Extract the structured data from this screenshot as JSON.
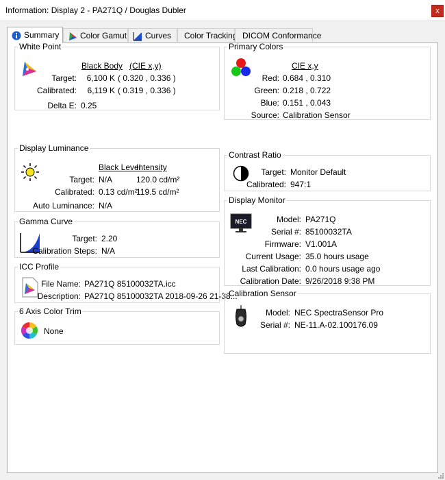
{
  "window": {
    "title": "Information: Display 2 - PA271Q / Douglas Dubler",
    "close_glyph": "x"
  },
  "tabs": [
    {
      "label": "Summary",
      "icon": "info-icon"
    },
    {
      "label": "Color Gamut",
      "icon": "gamut-icon"
    },
    {
      "label": "Curves",
      "icon": "curves-icon"
    },
    {
      "label": "Color Tracking",
      "icon": ""
    },
    {
      "label": "DICOM Conformance",
      "icon": ""
    }
  ],
  "white_point": {
    "title": "White Point",
    "col_black_body": "Black Body",
    "col_cie": "(CIE x,y)",
    "target_label": "Target:",
    "target_value": "6,100 K",
    "target_cie": "( 0.320 , 0.336 )",
    "calibrated_label": "Calibrated:",
    "calibrated_value": "6,119 K",
    "calibrated_cie": "( 0.319 , 0.336 )",
    "delta_label": "Delta E:",
    "delta_value": "0.25"
  },
  "display_luminance": {
    "title": "Display Luminance",
    "col_black": "Black Level",
    "col_intensity": "Intensity",
    "target_label": "Target:",
    "target_black": "N/A",
    "target_intensity": "120.0 cd/m²",
    "calibrated_label": "Calibrated:",
    "calibrated_black": "0.13 cd/m²",
    "calibrated_intensity": "119.5 cd/m²",
    "auto_label": "Auto Luminance:",
    "auto_value": "N/A"
  },
  "gamma_curve": {
    "title": "Gamma Curve",
    "target_label": "Target:",
    "target_value": "2.20",
    "steps_label": "Calibration Steps:",
    "steps_value": "N/A"
  },
  "icc_profile": {
    "title": "ICC Profile",
    "file_label": "File Name:",
    "file_value": "PA271Q 85100032TA.icc",
    "desc_label": "Description:",
    "desc_value": "PA271Q 85100032TA 2018-09-26 21-38..."
  },
  "six_axis": {
    "title": "6 Axis Color Trim",
    "value": "None"
  },
  "primary_colors": {
    "title": "Primary Colors",
    "col_cie": "CIE x,y",
    "red_label": "Red:",
    "red_value": "0.684 , 0.310",
    "green_label": "Green:",
    "green_value": "0.218 , 0.722",
    "blue_label": "Blue:",
    "blue_value": "0.151 , 0.043",
    "source_label": "Source:",
    "source_value": "Calibration Sensor"
  },
  "contrast_ratio": {
    "title": "Contrast Ratio",
    "target_label": "Target:",
    "target_value": "Monitor Default",
    "calibrated_label": "Calibrated:",
    "calibrated_value": "947:1"
  },
  "display_monitor": {
    "title": "Display Monitor",
    "icon_text": "NEC",
    "model_label": "Model:",
    "model_value": "PA271Q",
    "serial_label": "Serial #:",
    "serial_value": "85100032TA",
    "firmware_label": "Firmware:",
    "firmware_value": "V1.001A",
    "usage_label": "Current Usage:",
    "usage_value": "35.0 hours usage",
    "lastcal_label": "Last Calibration:",
    "lastcal_value": "0.0 hours usage ago",
    "caldate_label": "Calibration Date:",
    "caldate_value": "9/26/2018 9:38 PM"
  },
  "calibration_sensor": {
    "title": "Calibration Sensor",
    "model_label": "Model:",
    "model_value": "NEC SpectraSensor Pro",
    "serial_label": "Serial #:",
    "serial_value": "NE-11.A-02.100176.09"
  }
}
